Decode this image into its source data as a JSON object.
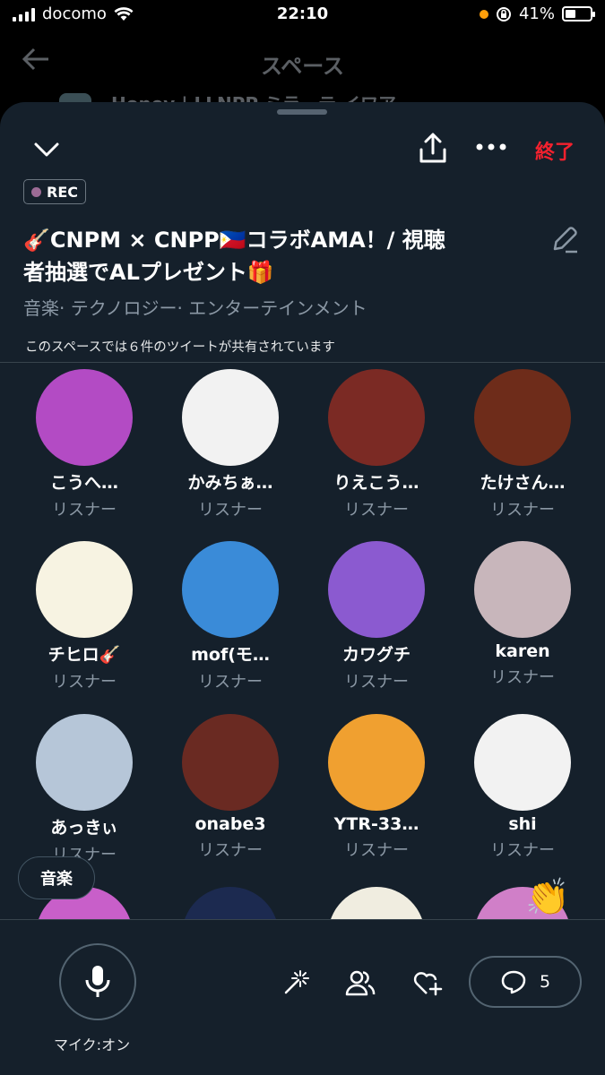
{
  "status_bar": {
    "carrier": "docomo",
    "time": "22:10",
    "battery": "41%"
  },
  "background": {
    "title": "スペース",
    "peek_text": "Honey   |   LLNPP   ミラーテ   イワア"
  },
  "sheet": {
    "end_label": "終了",
    "rec_label": "REC",
    "title_line1": "🎸CNPM × CNPP🇵🇭コラボAMA！/ 視聴",
    "title_line2": "者抽選でALプレゼント🎁",
    "topics": "音楽· テクノロジー· エンターテインメント",
    "shared_tweets": "このスペースでは６件のツイートが共有されています"
  },
  "participants": [
    {
      "name": "こうへ…",
      "role": "リスナー",
      "color": "#b34bc4"
    },
    {
      "name": "かみちぁ…",
      "role": "リスナー",
      "color": "#f2f2f2"
    },
    {
      "name": "りえこう…",
      "role": "リスナー",
      "color": "#7b2a24"
    },
    {
      "name": "たけさん…",
      "role": "リスナー",
      "color": "#6e2c1a"
    },
    {
      "name": "チヒロ🎸",
      "role": "リスナー",
      "color": "#f7f3e2"
    },
    {
      "name": "mof(モ…",
      "role": "リスナー",
      "color": "#3a8bd8"
    },
    {
      "name": "カワグチ",
      "role": "リスナー",
      "color": "#8b5ad0"
    },
    {
      "name": "karen",
      "role": "リスナー",
      "color": "#c8b6bb"
    },
    {
      "name": "あっきぃ",
      "role": "リスナー",
      "color": "#b6c6d8"
    },
    {
      "name": "onabe3",
      "role": "リスナー",
      "color": "#6a2a22"
    },
    {
      "name": "YTR-33…",
      "role": "リスナー",
      "color": "#f0a030"
    },
    {
      "name": "shi",
      "role": "リスナー",
      "color": "#f2f2f2"
    },
    {
      "name": "",
      "role": "",
      "color": "#c85fc9"
    },
    {
      "name": "",
      "role": "",
      "color": "#1c2a50"
    },
    {
      "name": "",
      "role": "",
      "color": "#f0ede0"
    },
    {
      "name": "",
      "role": "",
      "color": "#d07fc8"
    }
  ],
  "topic_chip": "音楽",
  "bottom": {
    "mic_label": "マイク:オン",
    "comment_count": "5"
  },
  "colors": {
    "sheet_bg": "#15202b",
    "end_red": "#f4212e",
    "muted": "#8b98a5"
  }
}
